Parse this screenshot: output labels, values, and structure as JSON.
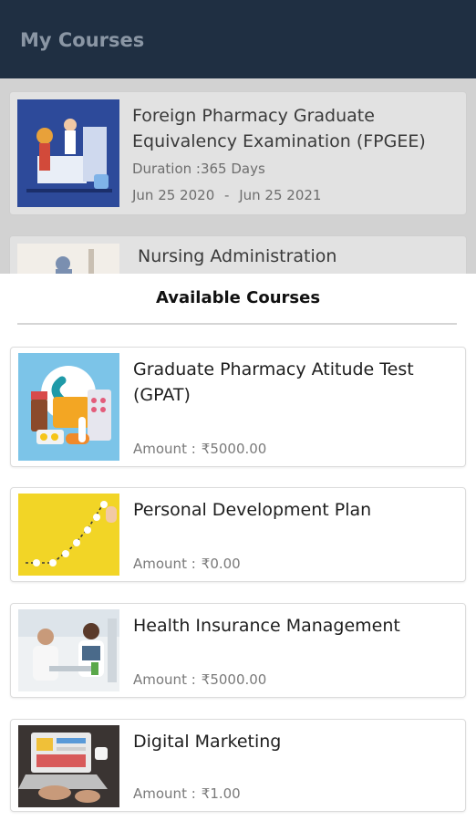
{
  "appbar": {
    "title": "My Courses"
  },
  "my_courses": [
    {
      "name": "Foreign Pharmacy Graduate Equivalency Examination (FPGEE)",
      "duration": "Duration :365 Days",
      "start": "Jun 25 2020",
      "end": "Jun 25 2021"
    },
    {
      "name": "Nursing Administration"
    }
  ],
  "available": {
    "title": "Available Courses",
    "amount_label": "Amount :",
    "courses": [
      {
        "name": "Graduate Pharmacy  Atitude Test (GPAT)",
        "amount": "₹5000.00",
        "thumb_icon": "pharmacy-illustration-icon"
      },
      {
        "name": "Personal Development Plan",
        "amount": "₹0.00",
        "thumb_icon": "growth-graph-icon"
      },
      {
        "name": "Health Insurance Management",
        "amount": "₹5000.00",
        "thumb_icon": "doctor-consultation-icon"
      },
      {
        "name": "Digital Marketing",
        "amount": "₹1.00",
        "thumb_icon": "laptop-work-icon"
      }
    ]
  },
  "colors": {
    "appbar": "#1f2f42",
    "sheet": "#ffffff",
    "overlay": "#d2d2d2"
  }
}
